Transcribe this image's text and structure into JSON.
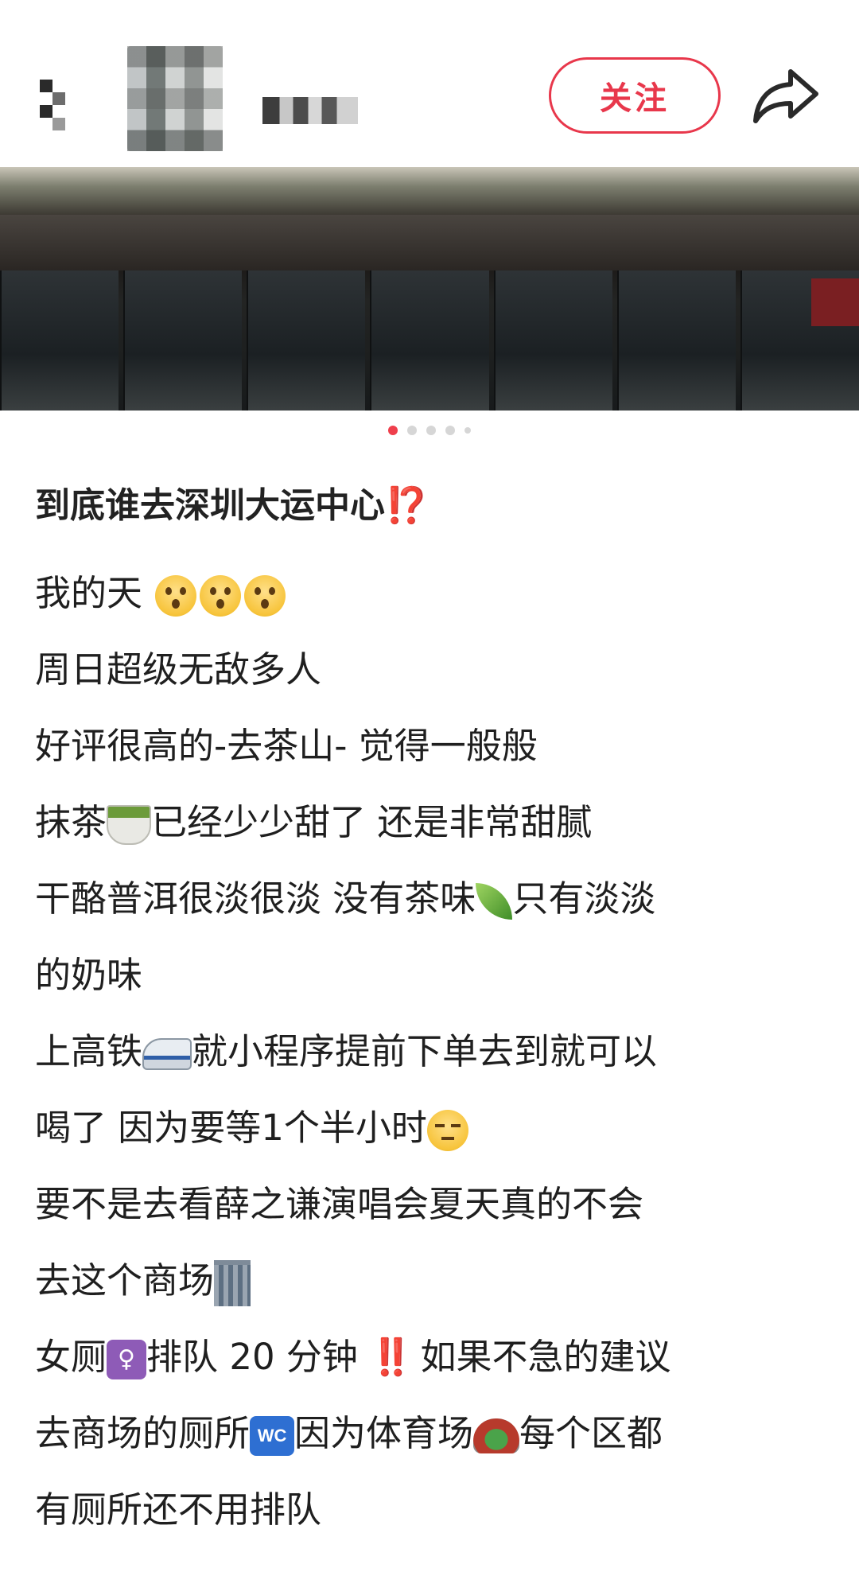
{
  "header": {
    "follow_label": "关注"
  },
  "carousel": {
    "total": 5,
    "active_index": 0
  },
  "post": {
    "title": "到底谁去深圳大运中心",
    "title_mark": "⁉️",
    "lines": [
      "我的天",
      "周日超级无敌多人",
      "好评很高的-去茶山- 觉得一般般",
      "抹茶",
      "已经少少甜了 还是非常甜腻",
      "干酪普洱很淡很淡 没有茶味",
      "只有淡淡",
      "的奶味",
      "上高铁",
      "就小程序提前下单去到就可以",
      "喝了 因为要等1个半小时",
      "要不是去看薛之谦演唱会夏天真的不会",
      "去这个商场",
      "女厕",
      "排队 20 分钟",
      "‼️",
      "如果不急的建议",
      "去商场的厕所",
      "WC",
      "因为体育场",
      "每个区都",
      "有厕所还不用排队"
    ]
  },
  "icons": {
    "back": "back-arrow-icon",
    "share": "share-arrow-icon"
  },
  "colors": {
    "accent": "#e8374b",
    "active_dot": "#ef3f4c"
  }
}
